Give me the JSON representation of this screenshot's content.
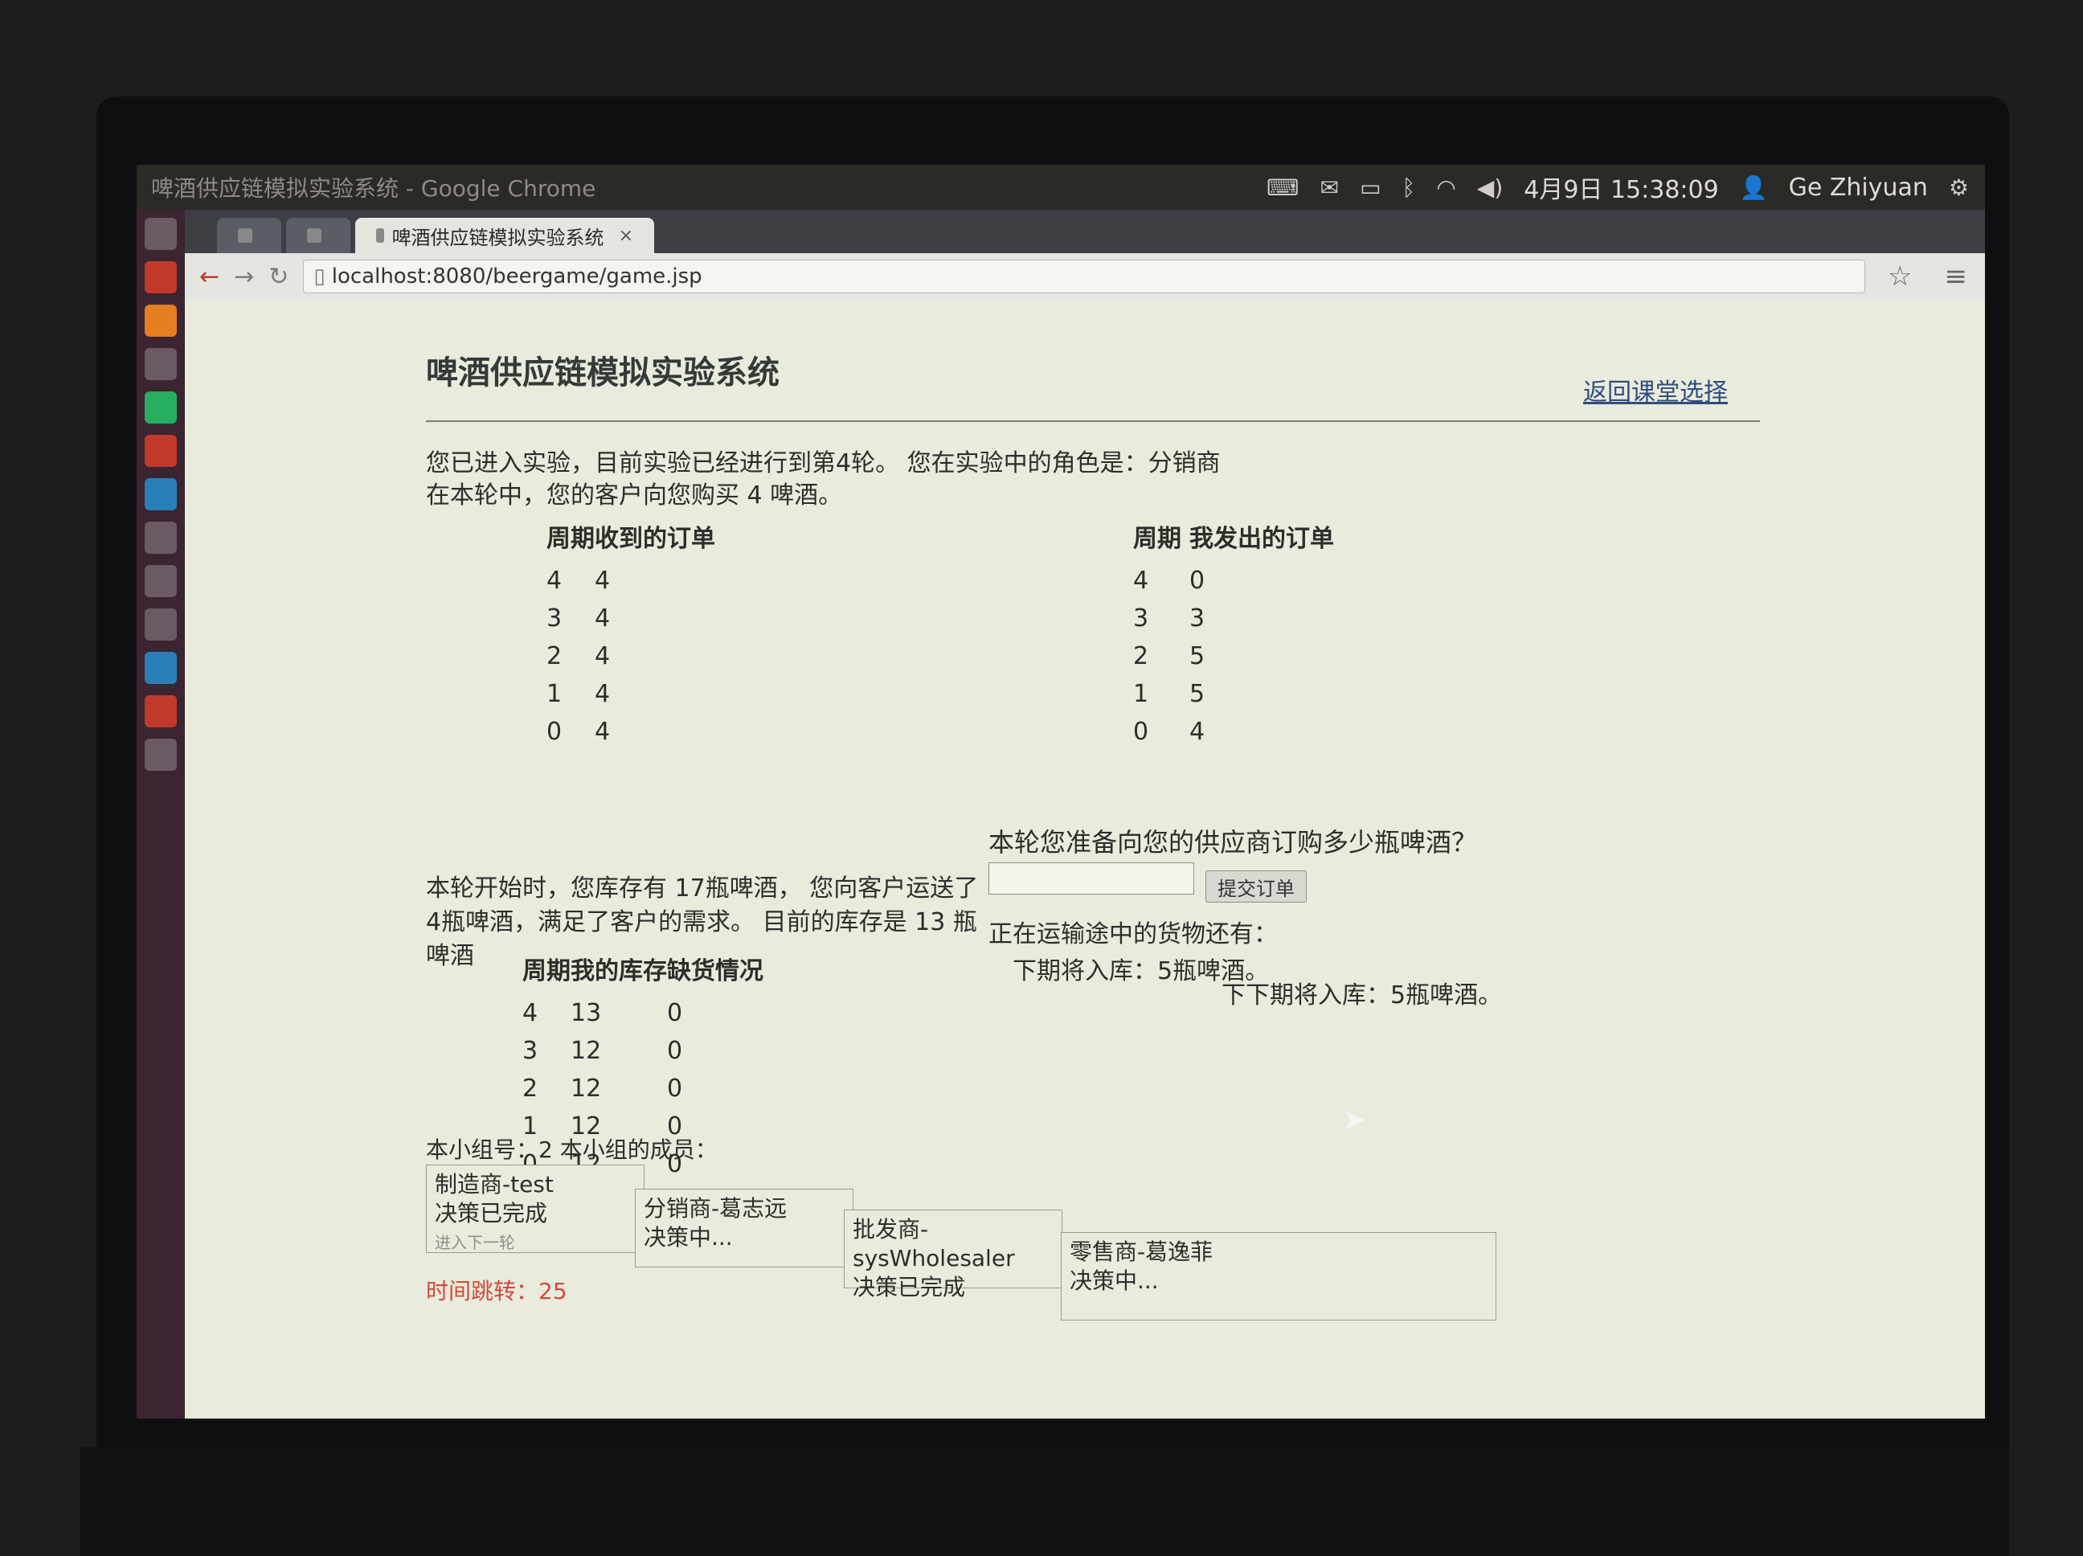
{
  "system_panel": {
    "window_title": "啤酒供应链模拟实验系统 - Google Chrome",
    "clock": "4月9日 15:38:09",
    "user": "Ge Zhiyuan",
    "icons": [
      "keyboard-icon",
      "mail-icon",
      "battery-icon",
      "bluetooth-icon",
      "wifi-icon",
      "volume-icon",
      "user-icon",
      "gear-icon"
    ]
  },
  "browser": {
    "tabs": [
      {
        "label": "",
        "active": false
      },
      {
        "label": "",
        "active": false
      },
      {
        "label": "啤酒供应链模拟实验系统",
        "active": true,
        "close": "×"
      }
    ],
    "url": "localhost:8080/beergame/game.jsp",
    "menu_glyph": "≡"
  },
  "page": {
    "title": "啤酒供应链模拟实验系统",
    "back_link": "返回课堂选择",
    "status_line": "您已进入实验，目前实验已经进行到第4轮。 您在实验中的角色是：分销商",
    "customer_line": "在本轮中，您的客户向您购买 4 啤酒。",
    "orders_received": {
      "headers": [
        "周期",
        "收到的订单"
      ],
      "rows": [
        [
          "4",
          "4"
        ],
        [
          "3",
          "4"
        ],
        [
          "2",
          "4"
        ],
        [
          "1",
          "4"
        ],
        [
          "0",
          "4"
        ]
      ]
    },
    "orders_sent": {
      "headers": [
        "周期",
        "我发出的订单"
      ],
      "rows": [
        [
          "4",
          "0"
        ],
        [
          "3",
          "3"
        ],
        [
          "2",
          "5"
        ],
        [
          "1",
          "5"
        ],
        [
          "0",
          "4"
        ]
      ]
    },
    "order_question": "本轮您准备向您的供应商订购多少瓶啤酒？",
    "order_input_value": "",
    "submit_label": "提交订单",
    "inventory_text": "本轮开始时，您库存有 17瓶啤酒， 您向客户运送了 4瓶啤酒，满足了客户的需求。 目前的库存是 13 瓶啤酒",
    "inventory_table": {
      "headers": [
        "周期",
        "我的库存",
        "缺货情况"
      ],
      "rows": [
        [
          "4",
          "13",
          "0"
        ],
        [
          "3",
          "12",
          "0"
        ],
        [
          "2",
          "12",
          "0"
        ],
        [
          "1",
          "12",
          "0"
        ],
        [
          "0",
          "12",
          "0"
        ]
      ]
    },
    "transit_title": "正在运输途中的货物还有：",
    "next_period": "下期将入库：5瓶啤酒。",
    "next_next_period": "下下期将入库：5瓶啤酒。",
    "group_info": "本小组号：2 本小组的成员：",
    "members": [
      {
        "name": "制造商-test",
        "status": "决策已完成",
        "extra": "进入下一轮"
      },
      {
        "name": "分销商-葛志远",
        "status": "决策中..."
      },
      {
        "name": "批发商-sysWholesaler",
        "status": "决策已完成"
      },
      {
        "name": "零售商-葛逸菲",
        "status": "决策中..."
      }
    ],
    "countdown": "时间跳转：25"
  }
}
